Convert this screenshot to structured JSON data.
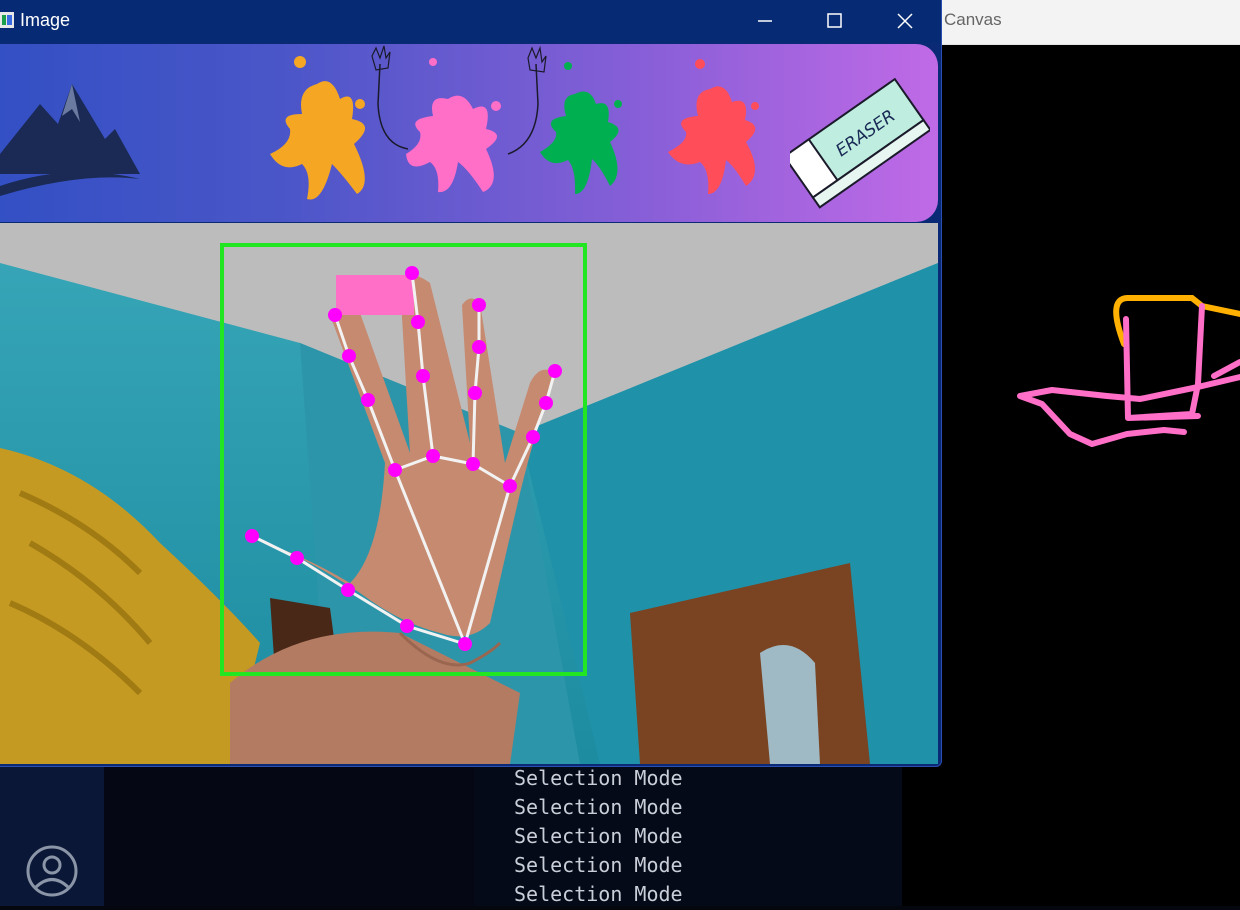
{
  "image_window": {
    "title": "Image",
    "controls": {
      "minimize": "minimize",
      "maximize": "maximize",
      "close": "close"
    },
    "toolbar": {
      "items": [
        {
          "name": "logo",
          "icon": "mountain-logo-icon",
          "color": "#1a2a55"
        },
        {
          "name": "yellow",
          "icon": "paint-splash-icon",
          "color": "#f5a623"
        },
        {
          "name": "pink",
          "icon": "paint-splash-icon",
          "color": "#ff6ec7"
        },
        {
          "name": "green",
          "icon": "paint-splash-icon",
          "color": "#00b050"
        },
        {
          "name": "red",
          "icon": "paint-splash-icon",
          "color": "#ff4d5a"
        },
        {
          "name": "eraser",
          "icon": "eraser-icon",
          "text": "ERASER",
          "color": "#bfeee0"
        }
      ]
    },
    "camera_feed": {
      "bounding_box_color": "#22e622",
      "landmark_color": "#ff00ff",
      "connection_color": "#f2f2f2",
      "selection_indicator_color": "#ff6ec7"
    }
  },
  "canvas_window": {
    "title": "Canvas",
    "stroke_colors": [
      "#ffb000",
      "#ff6ec7"
    ]
  },
  "terminal": {
    "lines": [
      "Selection Mode",
      "Selection Mode",
      "Selection Mode",
      "Selection Mode",
      "Selection Mode"
    ]
  }
}
